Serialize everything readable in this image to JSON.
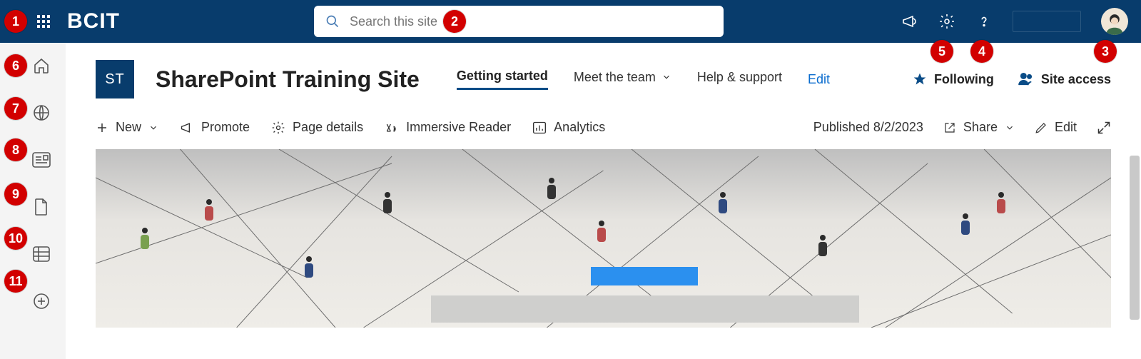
{
  "suite": {
    "brand": "BCIT",
    "search_placeholder": "Search this site"
  },
  "site": {
    "logo_text": "ST",
    "title": "SharePoint Training Site",
    "nav": {
      "item1": "Getting started",
      "item2": "Meet the team",
      "item3": "Help & support",
      "edit": "Edit"
    },
    "actions": {
      "following": "Following",
      "site_access": "Site access"
    }
  },
  "cmd": {
    "new": "New",
    "promote": "Promote",
    "page_details": "Page details",
    "immersive": "Immersive Reader",
    "analytics": "Analytics",
    "published": "Published 8/2/2023",
    "share": "Share",
    "edit": "Edit"
  },
  "callouts": {
    "c1": "1",
    "c2": "2",
    "c3": "3",
    "c4": "4",
    "c5": "5",
    "c6": "6",
    "c7": "7",
    "c8": "8",
    "c9": "9",
    "c10": "10",
    "c11": "11"
  }
}
